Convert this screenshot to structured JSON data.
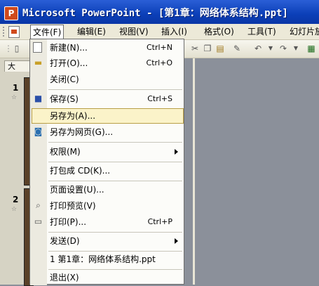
{
  "window": {
    "title": "Microsoft PowerPoint - [第1章：网络体系结构.ppt]"
  },
  "menubar": {
    "items": [
      {
        "label": "文件(F)"
      },
      {
        "label": "编辑(E)"
      },
      {
        "label": "视图(V)"
      },
      {
        "label": "插入(I)"
      },
      {
        "label": "格式(O)"
      },
      {
        "label": "工具(T)"
      },
      {
        "label": "幻灯片放"
      }
    ]
  },
  "left_panel": {
    "tab_label": "大",
    "slides": [
      {
        "number": "1",
        "star": "☆"
      },
      {
        "number": "2",
        "star": "☆"
      }
    ]
  },
  "file_menu": {
    "items": [
      {
        "label": "新建(N)...",
        "shortcut": "Ctrl+N",
        "icon": "new-document-icon"
      },
      {
        "label": "打开(O)...",
        "shortcut": "Ctrl+O",
        "icon": "open-folder-icon"
      },
      {
        "label": "关闭(C)",
        "shortcut": ""
      },
      {
        "label": "保存(S)",
        "shortcut": "Ctrl+S",
        "icon": "save-disk-icon"
      },
      {
        "label": "另存为(A)...",
        "shortcut": ""
      },
      {
        "label": "另存为网页(G)...",
        "shortcut": "",
        "icon": "web-page-icon"
      },
      {
        "label": "权限(M)",
        "shortcut": "",
        "submenu": true
      },
      {
        "label": "打包成 CD(K)...",
        "shortcut": ""
      },
      {
        "label": "页面设置(U)...",
        "shortcut": ""
      },
      {
        "label": "打印预览(V)",
        "shortcut": "",
        "icon": "print-preview-icon"
      },
      {
        "label": "打印(P)...",
        "shortcut": "Ctrl+P",
        "icon": "printer-icon"
      },
      {
        "label": "发送(D)",
        "shortcut": "",
        "submenu": true
      },
      {
        "label": "1 第1章：网络体系结构.ppt",
        "shortcut": ""
      },
      {
        "label": "退出(X)",
        "shortcut": ""
      }
    ]
  },
  "colors": {
    "titlebar": "#0b3fb8",
    "menu_highlight": "#fbf3c9",
    "workarea": "#8b909a"
  }
}
